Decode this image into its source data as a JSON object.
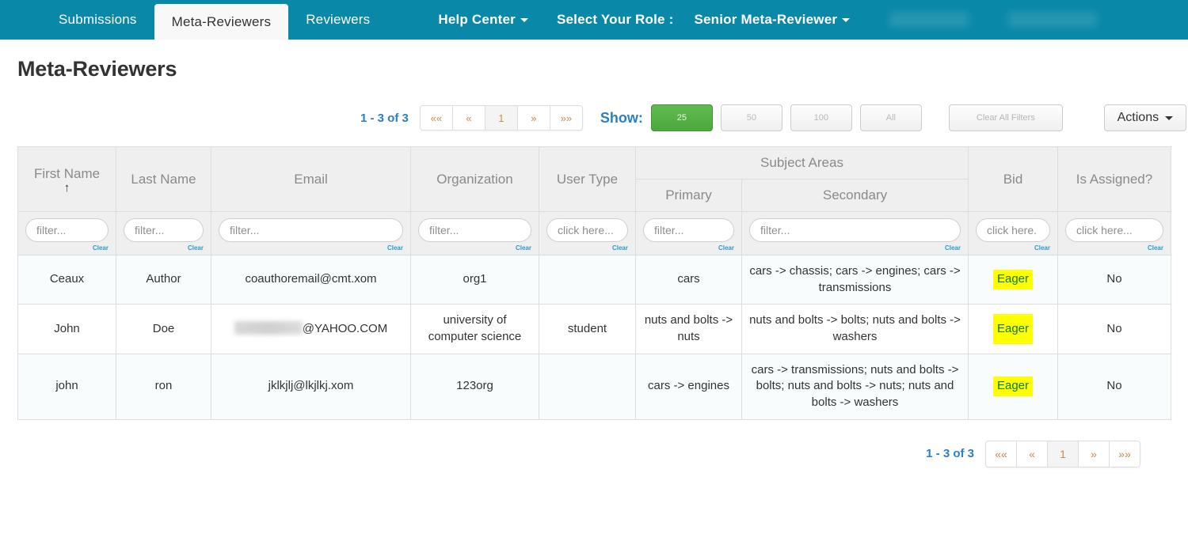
{
  "navbar": {
    "items": [
      {
        "label": "Submissions",
        "active": false,
        "bold": false,
        "caret": false
      },
      {
        "label": "Meta-Reviewers",
        "active": true,
        "bold": false,
        "caret": false
      },
      {
        "label": "Reviewers",
        "active": false,
        "bold": false,
        "caret": false
      }
    ],
    "right_items": [
      {
        "label": "Help Center",
        "bold": true,
        "caret": true
      },
      {
        "label": "Select Your Role :",
        "bold": true,
        "caret": false
      },
      {
        "label": "Senior Meta-Reviewer",
        "bold": true,
        "caret": true
      }
    ],
    "background_color": "#0a88a8",
    "active_tab_color": "#f8f8f8"
  },
  "page": {
    "title": "Meta-Reviewers"
  },
  "toolbar": {
    "count_label": "1 - 3 of 3",
    "pager": [
      {
        "label": "««",
        "current": false
      },
      {
        "label": "«",
        "current": false
      },
      {
        "label": "1",
        "current": true
      },
      {
        "label": "»",
        "current": false
      },
      {
        "label": "»»",
        "current": false
      }
    ],
    "show_label": "Show:",
    "page_sizes": [
      {
        "label": "25",
        "active": true
      },
      {
        "label": "50",
        "active": false
      },
      {
        "label": "100",
        "active": false
      },
      {
        "label": "All",
        "active": false
      }
    ],
    "clear_all_filters_label": "Clear All Filters",
    "actions_label": "Actions",
    "active_size_color": "#4aa83c"
  },
  "table": {
    "headers": {
      "first_name": "First Name",
      "last_name": "Last Name",
      "email": "Email",
      "organization": "Organization",
      "user_type": "User Type",
      "subject_areas": "Subject Areas",
      "primary": "Primary",
      "secondary": "Secondary",
      "bid": "Bid",
      "is_assigned": "Is Assigned?"
    },
    "sort": {
      "column": "first_name",
      "direction": "ascending",
      "glyph": "↑"
    },
    "filters": [
      {
        "name": "first-name",
        "placeholder": "filter...",
        "value": "",
        "clear": "Clear"
      },
      {
        "name": "last-name",
        "placeholder": "filter...",
        "value": "",
        "clear": "Clear"
      },
      {
        "name": "email",
        "placeholder": "filter...",
        "value": "",
        "clear": "Clear"
      },
      {
        "name": "organization",
        "placeholder": "filter...",
        "value": "",
        "clear": "Clear"
      },
      {
        "name": "user-type",
        "placeholder": "click here...",
        "value": "",
        "clear": "Clear"
      },
      {
        "name": "primary",
        "placeholder": "filter...",
        "value": "",
        "clear": "Clear"
      },
      {
        "name": "secondary",
        "placeholder": "filter...",
        "value": "",
        "clear": "Clear"
      },
      {
        "name": "bid",
        "placeholder": "click here.",
        "value": "",
        "clear": "Clear"
      },
      {
        "name": "is-assigned",
        "placeholder": "click here...",
        "value": "",
        "clear": "Clear"
      }
    ],
    "rows": [
      {
        "first_name": "Ceaux",
        "last_name": "Author",
        "email": "coauthoremail@cmt.xom",
        "email_redacted": false,
        "email_suffix": "",
        "organization": "org1",
        "user_type": "",
        "primary": "cars",
        "secondary": "cars -> chassis; cars -> engines; cars -> transmissions",
        "bid": "Eager",
        "is_assigned": "No"
      },
      {
        "first_name": "John",
        "last_name": "Doe",
        "email": "",
        "email_redacted": true,
        "email_suffix": "@YAHOO.COM",
        "organization": "university of computer science",
        "user_type": "student",
        "primary": "nuts and bolts -> nuts",
        "secondary": "nuts and bolts -> bolts; nuts and bolts -> washers",
        "bid": "Eager",
        "is_assigned": "No"
      },
      {
        "first_name": "john",
        "last_name": "ron",
        "email": "jklkjlj@lkjlkj.xom",
        "email_redacted": false,
        "email_suffix": "",
        "organization": "123org",
        "user_type": "",
        "primary": "cars -> engines",
        "secondary": "cars -> transmissions; nuts and bolts -> bolts; nuts and bolts -> nuts; nuts and bolts -> washers",
        "bid": "Eager",
        "is_assigned": "No"
      }
    ],
    "bid_badge_color": "#ffff00",
    "bid_text_color": "#0a7a28"
  },
  "bottom": {
    "count_label": "1 - 3 of 3",
    "pager": [
      {
        "label": "««",
        "current": false
      },
      {
        "label": "«",
        "current": false
      },
      {
        "label": "1",
        "current": true
      },
      {
        "label": "»",
        "current": false
      },
      {
        "label": "»»",
        "current": false
      }
    ]
  }
}
